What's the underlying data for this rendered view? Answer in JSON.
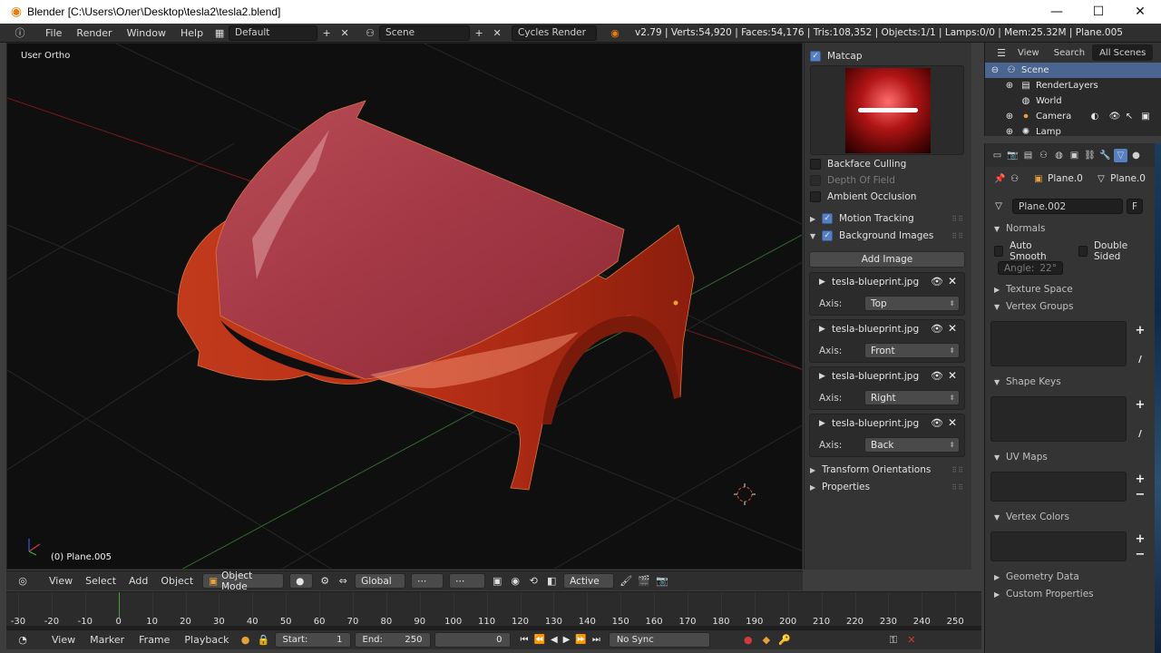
{
  "window": {
    "title": "Blender [C:\\Users\\Олег\\Desktop\\tesla2\\tesla2.blend]",
    "minimize": "—",
    "maximize": "☐",
    "close": "✕"
  },
  "topbar": {
    "menu": [
      "File",
      "Render",
      "Window",
      "Help"
    ],
    "layout": "Default",
    "scene": "Scene",
    "engine": "Cycles Render",
    "stats": "v2.79 | Verts:54,920 | Faces:54,176 | Tris:108,352 | Objects:1/1 | Lamps:0/0 | Mem:25.32M | Plane.005"
  },
  "viewport": {
    "view_label": "User Ortho",
    "object_label": "(0) Plane.005"
  },
  "npanel": {
    "matcap_label": "Matcap",
    "backface_culling": "Backface Culling",
    "depth_of_field": "Depth Of Field",
    "ambient_occlusion": "Ambient Occlusion",
    "motion_tracking": "Motion Tracking",
    "background_images": "Background Images",
    "add_image": "Add Image",
    "axis_label": "Axis:",
    "images": [
      {
        "name": "tesla-blueprint.jpg",
        "axis": "Top"
      },
      {
        "name": "tesla-blueprint.jpg",
        "axis": "Front"
      },
      {
        "name": "tesla-blueprint.jpg",
        "axis": "Right"
      },
      {
        "name": "tesla-blueprint.jpg",
        "axis": "Back"
      }
    ],
    "transform_orientations": "Transform Orientations",
    "properties": "Properties"
  },
  "outliner": {
    "tabs": [
      "View",
      "Search",
      "All Scenes"
    ],
    "items": [
      "Scene",
      "RenderLayers",
      "World",
      "Camera",
      "Lamp"
    ]
  },
  "props": {
    "breadcrumb_obj": "Plane.0",
    "breadcrumb_data": "Plane.0",
    "mesh_name": "Plane.002",
    "fake_user": "F",
    "normals": "Normals",
    "auto_smooth": "Auto Smooth",
    "double_sided": "Double Sided",
    "angle": "Angle:",
    "angle_value": "22°",
    "texture_space": "Texture Space",
    "vertex_groups": "Vertex Groups",
    "shape_keys": "Shape Keys",
    "uv_maps": "UV Maps",
    "vertex_colors": "Vertex Colors",
    "geometry_data": "Geometry Data",
    "custom_properties": "Custom Properties"
  },
  "vp_header": {
    "menu": [
      "View",
      "Select",
      "Add",
      "Object"
    ],
    "mode": "Object Mode",
    "orientation": "Global",
    "pivot": "Active"
  },
  "timeline": {
    "frames": [
      -30,
      -20,
      -10,
      0,
      10,
      20,
      30,
      40,
      50,
      60,
      70,
      80,
      90,
      100,
      110,
      120,
      130,
      140,
      150,
      160,
      170,
      180,
      190,
      200,
      210,
      220,
      230,
      240,
      250
    ],
    "current_frame": 0
  },
  "tl_header": {
    "menu": [
      "View",
      "Marker",
      "Frame",
      "Playback"
    ],
    "start_label": "Start:",
    "start_value": "1",
    "end_label": "End:",
    "end_value": "250",
    "current_value": "0",
    "sync": "No Sync"
  },
  "colors": {
    "accent": "#5680c2",
    "car_body": "#c63a1f",
    "background": "#0f0f0f"
  }
}
